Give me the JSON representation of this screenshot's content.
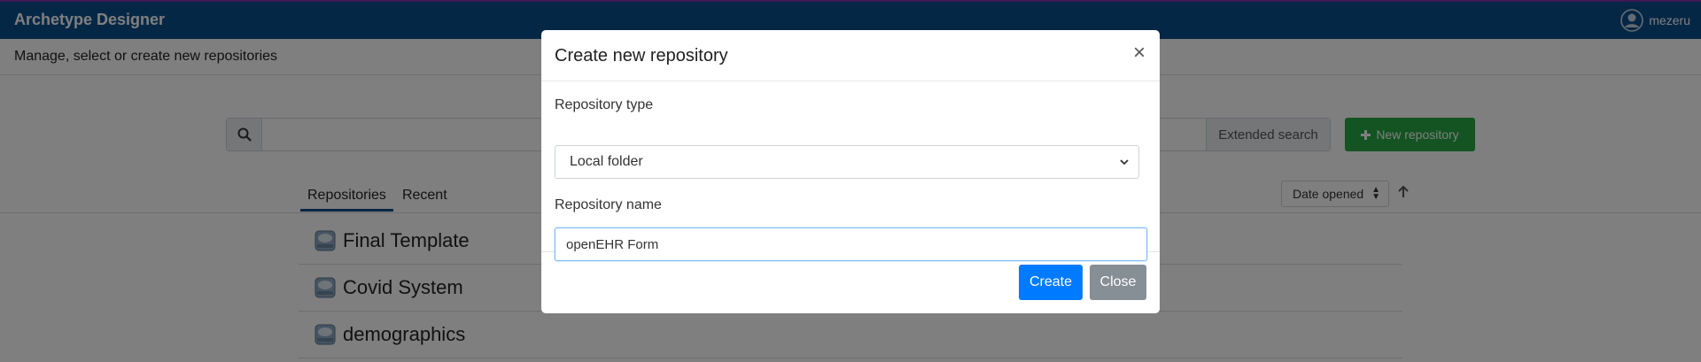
{
  "header": {
    "app_title": "Archetype Designer",
    "user_name": "mezeru",
    "brand_color": "#0a4f8c"
  },
  "subheader": {
    "text": "Manage, select or create new repositories"
  },
  "search": {
    "placeholder": "",
    "extended_label": "Extended search",
    "icon": "search-icon"
  },
  "toolbar": {
    "new_repo_label": "New repository",
    "new_repo_color": "#28a745"
  },
  "tabs": [
    {
      "label": "Repositories",
      "active": true
    },
    {
      "label": "Recent",
      "active": false
    }
  ],
  "sort": {
    "selected": "Date opened",
    "direction_icon": "arrow-up-icon"
  },
  "repositories": [
    {
      "name": "Final Template"
    },
    {
      "name": "Covid System"
    },
    {
      "name": "demographics"
    }
  ],
  "modal": {
    "title": "Create new repository",
    "close_symbol": "×",
    "type_label": "Repository type",
    "type_value": "Local folder",
    "name_label": "Repository name",
    "name_value": "openEHR Form",
    "create_label": "Create",
    "close_label": "Close",
    "create_color": "#007bff",
    "close_color": "#868e96"
  }
}
